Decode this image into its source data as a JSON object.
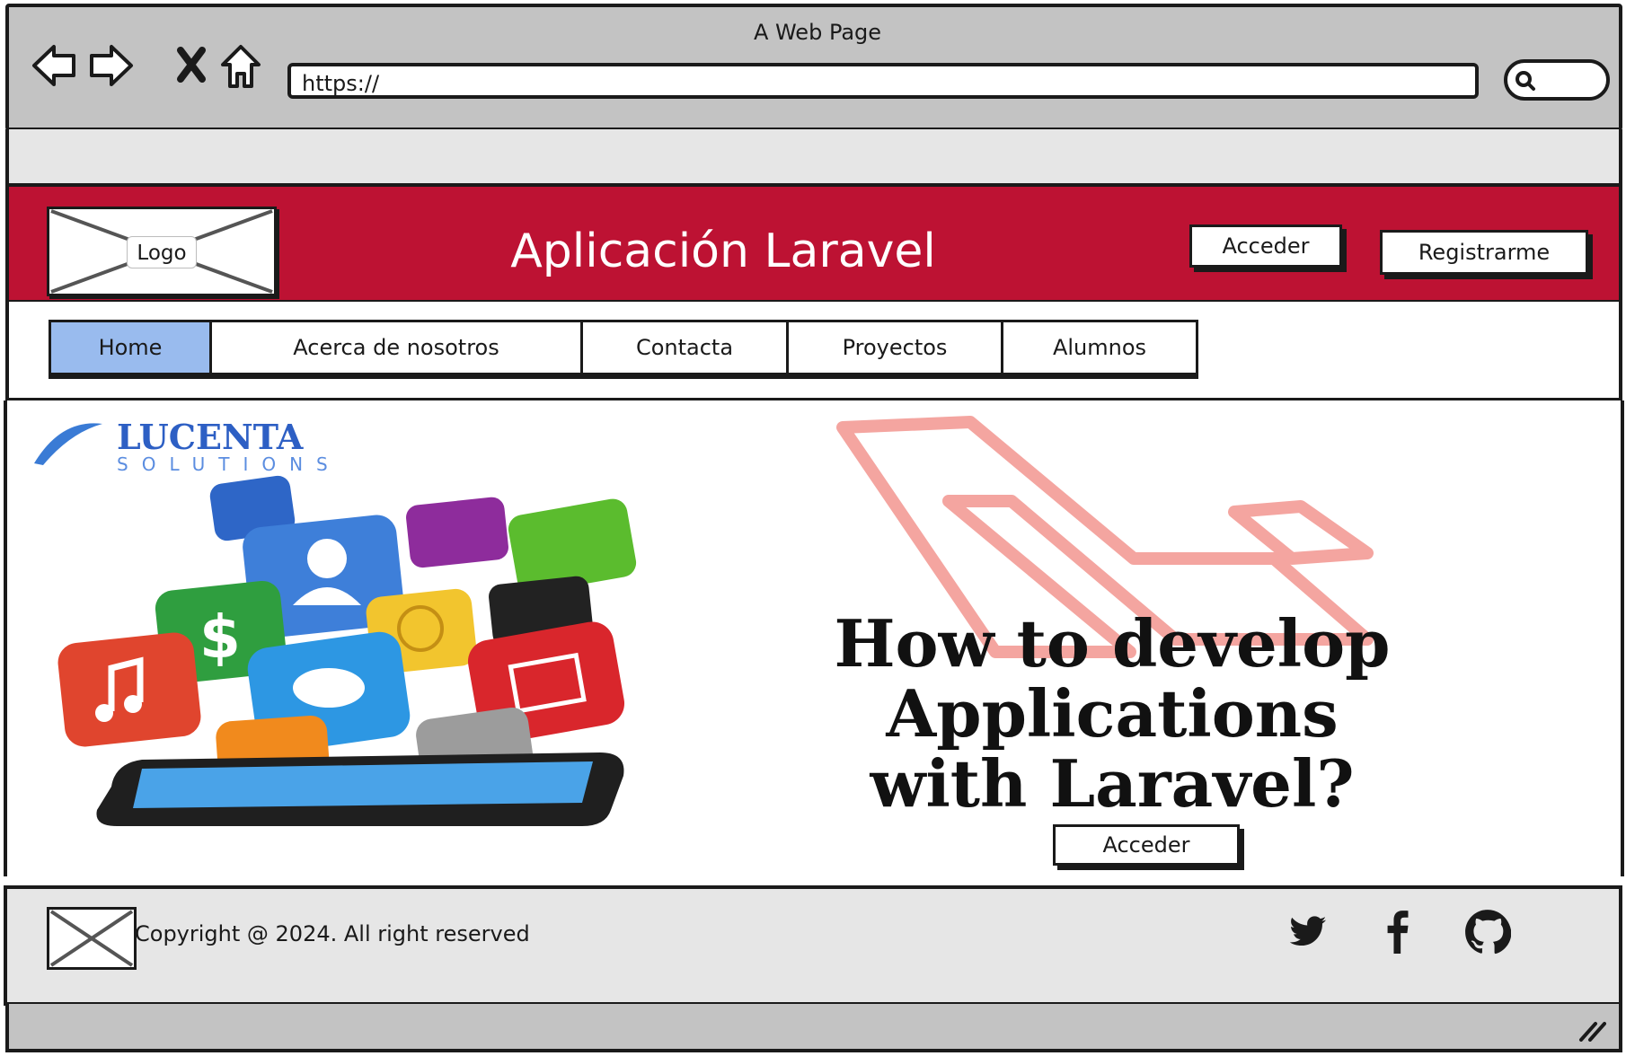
{
  "browser": {
    "title": "A Web Page",
    "url": "https://",
    "icons": [
      "back-arrow-icon",
      "forward-arrow-icon",
      "close-x-icon",
      "home-icon",
      "search-icon"
    ]
  },
  "header": {
    "logo_label": "Logo",
    "app_title": "Aplicación Laravel",
    "login_label": "Acceder",
    "register_label": "Registrarme",
    "background_color": "#bd1233"
  },
  "nav": {
    "tabs": [
      {
        "label": "Home",
        "active": true
      },
      {
        "label": "Acerca de nosotros",
        "active": false
      },
      {
        "label": "Contacta",
        "active": false
      },
      {
        "label": "Proyectos",
        "active": false
      },
      {
        "label": "Alumnos",
        "active": false
      }
    ],
    "active_color": "#99bbee"
  },
  "hero": {
    "brand_name": "LUCENTA",
    "brand_tagline": "SOLUTIONS",
    "headline_line1": "How to develop",
    "headline_line2": "Applications",
    "headline_line3": "with Laravel?",
    "cta_label": "Acceder"
  },
  "footer": {
    "copyright": "Copyright @ 2024. All right reserved",
    "social_icons": [
      "twitter-icon",
      "facebook-icon",
      "github-icon"
    ]
  }
}
